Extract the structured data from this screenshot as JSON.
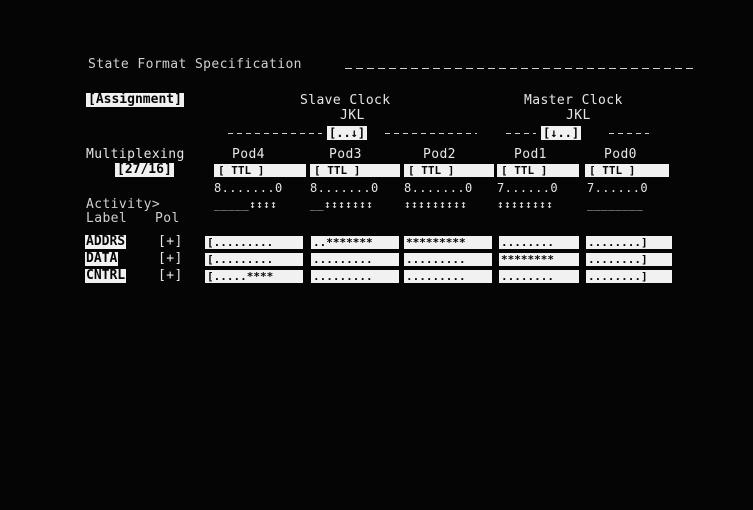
{
  "title": "State Format Specification",
  "assignment_label": "[Assignment]",
  "slave_clock": {
    "title": "Slave Clock",
    "sub": "JKL",
    "value": "[..↓]"
  },
  "master_clock": {
    "title": "Master Clock",
    "sub": "JKL",
    "value": "[↓..]"
  },
  "multiplexing": {
    "label": "Multiplexing",
    "value": "[27/16]"
  },
  "pods": [
    {
      "name": "Pod4",
      "type": "[ TTL ]",
      "bits": "8.......0",
      "activity": "_____↕↕↕↕"
    },
    {
      "name": "Pod3",
      "type": "[ TTL ]",
      "bits": "8.......0",
      "activity": "__↕↕↕↕↕↕↕"
    },
    {
      "name": "Pod2",
      "type": "[ TTL ]",
      "bits": "8.......0",
      "activity": "↕↕↕↕↕↕↕↕↕"
    },
    {
      "name": "Pod1",
      "type": "[ TTL ]",
      "bits": "7......0",
      "activity": "↕↕↕↕↕↕↕↕"
    },
    {
      "name": "Pod0",
      "type": "[ TTL ]",
      "bits": "7......0",
      "activity": "________"
    }
  ],
  "activity_label": "Activity>",
  "label_header": "Label",
  "pol_header": "Pol",
  "rows": [
    {
      "label": "ADDRS",
      "pol": "[+]",
      "cells": [
        "[.........",
        "..*******",
        "*********",
        "........",
        "........]"
      ]
    },
    {
      "label": "DATA",
      "pol": "[+]",
      "cells": [
        "[.........",
        ".........",
        ".........",
        "********",
        "........]"
      ]
    },
    {
      "label": "CNTRL",
      "pol": "[+]",
      "cells": [
        "[.....****",
        ".........",
        ".........",
        "........",
        "........]"
      ]
    }
  ]
}
